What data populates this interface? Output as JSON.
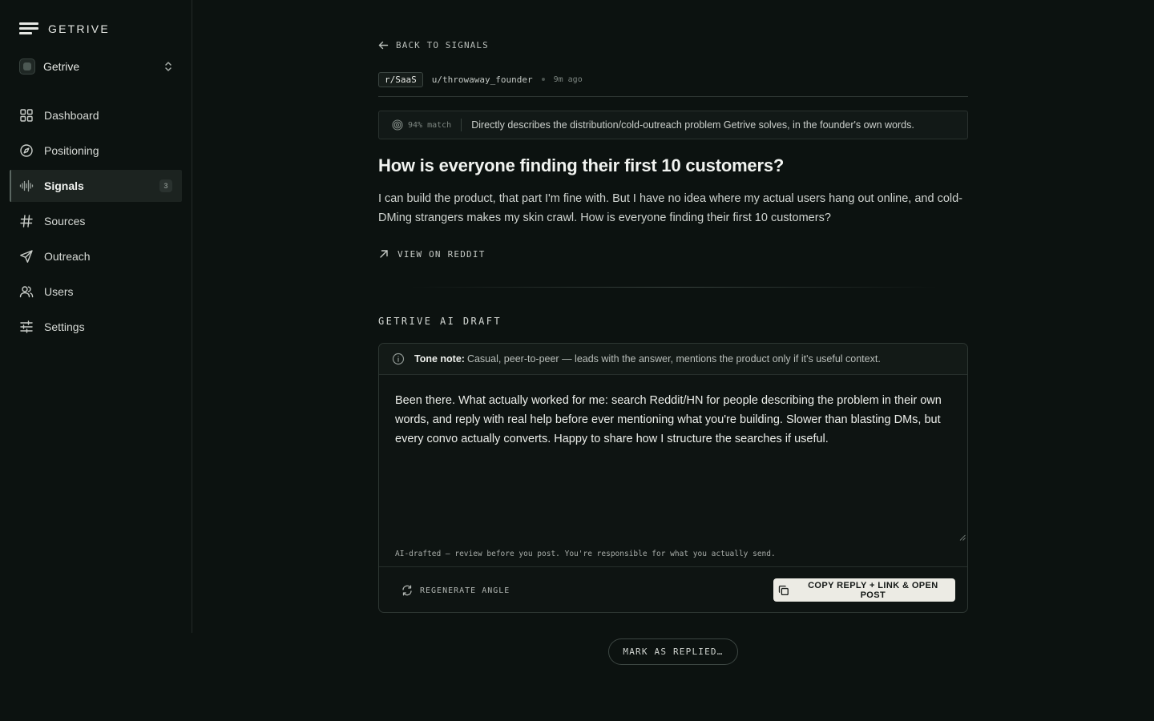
{
  "brand": {
    "name": "GETRIVE"
  },
  "workspace": {
    "name": "Getrive"
  },
  "nav": [
    {
      "id": "dashboard",
      "label": "Dashboard",
      "icon": "grid-icon"
    },
    {
      "id": "positioning",
      "label": "Positioning",
      "icon": "compass-icon"
    },
    {
      "id": "signals",
      "label": "Signals",
      "icon": "waveform-icon",
      "active": true,
      "badge": "3"
    },
    {
      "id": "sources",
      "label": "Sources",
      "icon": "hash-icon"
    },
    {
      "id": "outreach",
      "label": "Outreach",
      "icon": "send-icon"
    },
    {
      "id": "users",
      "label": "Users",
      "icon": "users-icon"
    },
    {
      "id": "settings",
      "label": "Settings",
      "icon": "sliders-icon"
    }
  ],
  "post": {
    "back_label": "BACK TO SIGNALS",
    "subreddit": "r/SaaS",
    "author": "u/throwaway_founder",
    "age": "9m ago",
    "match_score": "94% match",
    "match_reason": "Directly describes the distribution/cold-outreach problem Getrive solves, in the founder's own words.",
    "title": "How is everyone finding their first 10 customers?",
    "body": "I can build the product, that part I'm fine with. But I have no idea where my actual users hang out online, and cold-DMing strangers makes my skin crawl. How is everyone finding their first 10 customers?",
    "view_link": "VIEW ON REDDIT"
  },
  "draft": {
    "section_label": "GETRIVE AI DRAFT",
    "tone_label": "Tone note:",
    "tone_text": "Casual, peer-to-peer — leads with the answer, mentions the product only if it's useful context.",
    "text": "Been there. What actually worked for me: search Reddit/HN for people describing the problem in their own words, and reply with real help before ever mentioning what you're building. Slower than blasting DMs, but every convo actually converts. Happy to share how I structure the searches if useful.",
    "disclaimer": "AI-drafted — review before you post. You're responsible for what you actually send.",
    "regenerate_label": "REGENERATE ANGLE",
    "copy_label": "COPY REPLY + LINK & OPEN POST",
    "mark_label": "MARK AS REPLIED…"
  },
  "colors": {
    "background": "#0c1210",
    "accent_button": "#ecebe4",
    "border": "#2e3733"
  }
}
